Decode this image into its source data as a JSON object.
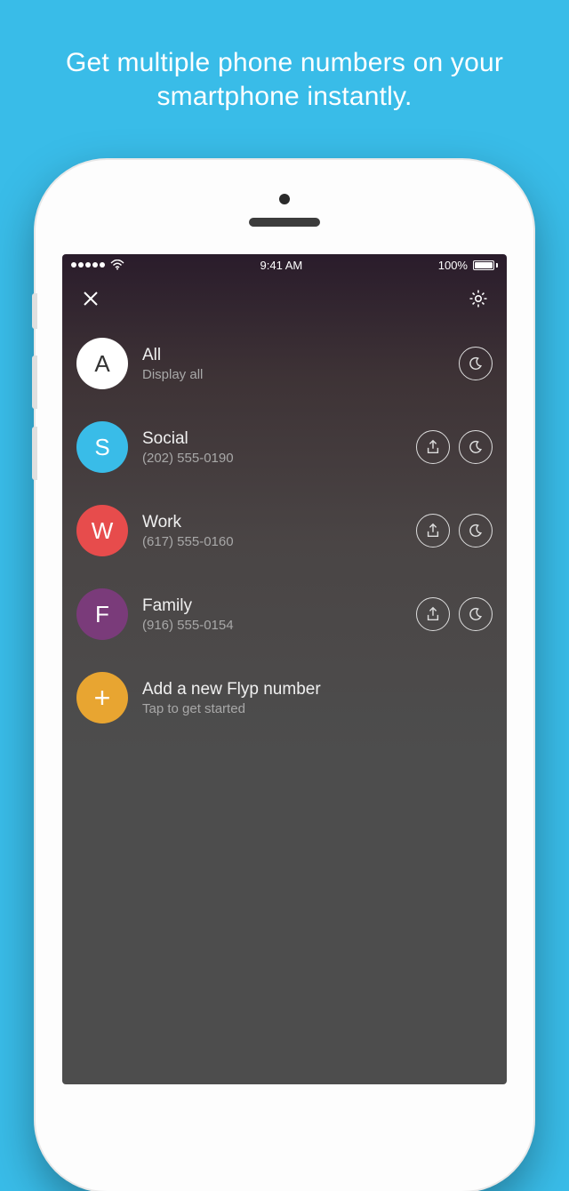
{
  "marketing": {
    "headline": "Get multiple phone numbers on your smartphone instantly."
  },
  "statusbar": {
    "time": "9:41 AM",
    "battery": "100%"
  },
  "rows": [
    {
      "letter": "A",
      "title": "All",
      "sub": "Display all",
      "avatar": "white",
      "share": false,
      "moon": true,
      "add": false
    },
    {
      "letter": "S",
      "title": "Social",
      "sub": "(202) 555-0190",
      "avatar": "blue",
      "share": true,
      "moon": true,
      "add": false
    },
    {
      "letter": "W",
      "title": "Work",
      "sub": "(617) 555-0160",
      "avatar": "red",
      "share": true,
      "moon": true,
      "add": false
    },
    {
      "letter": "F",
      "title": "Family",
      "sub": "(916) 555-0154",
      "avatar": "purple",
      "share": true,
      "moon": true,
      "add": false
    },
    {
      "letter": "+",
      "title": "Add a new Flyp number",
      "sub": "Tap to get started",
      "avatar": "orange",
      "share": false,
      "moon": false,
      "add": true
    }
  ]
}
